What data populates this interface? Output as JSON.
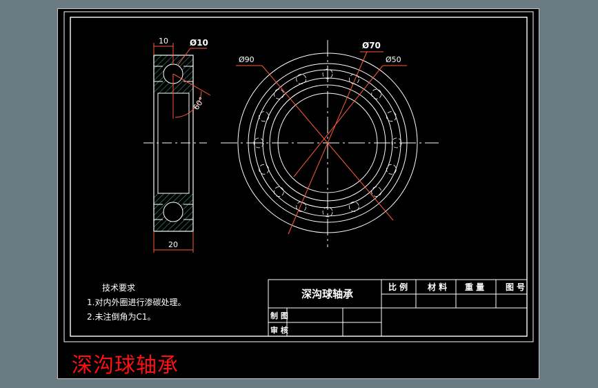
{
  "part_view": {
    "dim_width_top": "10",
    "dim_ball_dia": "Ø10",
    "dim_angle": "60°",
    "dim_width_bottom": "20"
  },
  "front_view": {
    "dim_d90": "Ø90",
    "dim_d70": "Ø70",
    "dim_d50": "Ø50"
  },
  "tech_requirements": {
    "heading": "技术要求",
    "item1": "1.对内外圈进行渗碳处理。",
    "item2": "2.未注倒角为C1。"
  },
  "title_block": {
    "name": "深沟球轴承",
    "col_scale": "比 例",
    "col_material": "材 料",
    "col_weight": "重 量",
    "col_drawing_no": "图 号",
    "row_drawn": "制 图",
    "row_checked": "审 核"
  },
  "caption": "深沟球轴承",
  "colors": {
    "background": "#6b7b84",
    "drawing_area": "#000000",
    "line": "#ffffff",
    "dimension": "#ff5a3c",
    "hatch": "#3fa08a",
    "caption": "#ff1010"
  }
}
